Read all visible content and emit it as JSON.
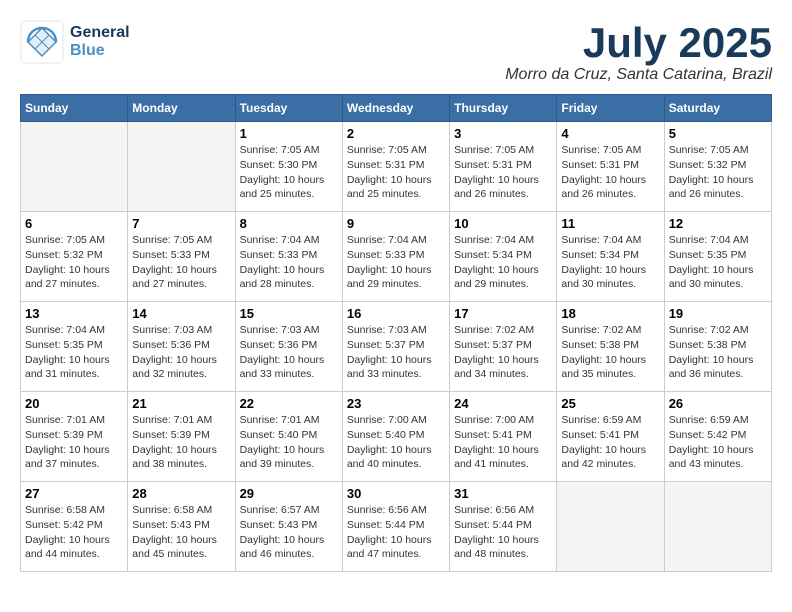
{
  "header": {
    "logo_general": "General",
    "logo_blue": "Blue",
    "month_title": "July 2025",
    "location": "Morro da Cruz, Santa Catarina, Brazil"
  },
  "weekdays": [
    "Sunday",
    "Monday",
    "Tuesday",
    "Wednesday",
    "Thursday",
    "Friday",
    "Saturday"
  ],
  "weeks": [
    [
      {
        "date": "",
        "info": ""
      },
      {
        "date": "",
        "info": ""
      },
      {
        "date": "1",
        "sunrise": "Sunrise: 7:05 AM",
        "sunset": "Sunset: 5:30 PM",
        "daylight": "Daylight: 10 hours and 25 minutes."
      },
      {
        "date": "2",
        "sunrise": "Sunrise: 7:05 AM",
        "sunset": "Sunset: 5:31 PM",
        "daylight": "Daylight: 10 hours and 25 minutes."
      },
      {
        "date": "3",
        "sunrise": "Sunrise: 7:05 AM",
        "sunset": "Sunset: 5:31 PM",
        "daylight": "Daylight: 10 hours and 26 minutes."
      },
      {
        "date": "4",
        "sunrise": "Sunrise: 7:05 AM",
        "sunset": "Sunset: 5:31 PM",
        "daylight": "Daylight: 10 hours and 26 minutes."
      },
      {
        "date": "5",
        "sunrise": "Sunrise: 7:05 AM",
        "sunset": "Sunset: 5:32 PM",
        "daylight": "Daylight: 10 hours and 26 minutes."
      }
    ],
    [
      {
        "date": "6",
        "sunrise": "Sunrise: 7:05 AM",
        "sunset": "Sunset: 5:32 PM",
        "daylight": "Daylight: 10 hours and 27 minutes."
      },
      {
        "date": "7",
        "sunrise": "Sunrise: 7:05 AM",
        "sunset": "Sunset: 5:33 PM",
        "daylight": "Daylight: 10 hours and 27 minutes."
      },
      {
        "date": "8",
        "sunrise": "Sunrise: 7:04 AM",
        "sunset": "Sunset: 5:33 PM",
        "daylight": "Daylight: 10 hours and 28 minutes."
      },
      {
        "date": "9",
        "sunrise": "Sunrise: 7:04 AM",
        "sunset": "Sunset: 5:33 PM",
        "daylight": "Daylight: 10 hours and 29 minutes."
      },
      {
        "date": "10",
        "sunrise": "Sunrise: 7:04 AM",
        "sunset": "Sunset: 5:34 PM",
        "daylight": "Daylight: 10 hours and 29 minutes."
      },
      {
        "date": "11",
        "sunrise": "Sunrise: 7:04 AM",
        "sunset": "Sunset: 5:34 PM",
        "daylight": "Daylight: 10 hours and 30 minutes."
      },
      {
        "date": "12",
        "sunrise": "Sunrise: 7:04 AM",
        "sunset": "Sunset: 5:35 PM",
        "daylight": "Daylight: 10 hours and 30 minutes."
      }
    ],
    [
      {
        "date": "13",
        "sunrise": "Sunrise: 7:04 AM",
        "sunset": "Sunset: 5:35 PM",
        "daylight": "Daylight: 10 hours and 31 minutes."
      },
      {
        "date": "14",
        "sunrise": "Sunrise: 7:03 AM",
        "sunset": "Sunset: 5:36 PM",
        "daylight": "Daylight: 10 hours and 32 minutes."
      },
      {
        "date": "15",
        "sunrise": "Sunrise: 7:03 AM",
        "sunset": "Sunset: 5:36 PM",
        "daylight": "Daylight: 10 hours and 33 minutes."
      },
      {
        "date": "16",
        "sunrise": "Sunrise: 7:03 AM",
        "sunset": "Sunset: 5:37 PM",
        "daylight": "Daylight: 10 hours and 33 minutes."
      },
      {
        "date": "17",
        "sunrise": "Sunrise: 7:02 AM",
        "sunset": "Sunset: 5:37 PM",
        "daylight": "Daylight: 10 hours and 34 minutes."
      },
      {
        "date": "18",
        "sunrise": "Sunrise: 7:02 AM",
        "sunset": "Sunset: 5:38 PM",
        "daylight": "Daylight: 10 hours and 35 minutes."
      },
      {
        "date": "19",
        "sunrise": "Sunrise: 7:02 AM",
        "sunset": "Sunset: 5:38 PM",
        "daylight": "Daylight: 10 hours and 36 minutes."
      }
    ],
    [
      {
        "date": "20",
        "sunrise": "Sunrise: 7:01 AM",
        "sunset": "Sunset: 5:39 PM",
        "daylight": "Daylight: 10 hours and 37 minutes."
      },
      {
        "date": "21",
        "sunrise": "Sunrise: 7:01 AM",
        "sunset": "Sunset: 5:39 PM",
        "daylight": "Daylight: 10 hours and 38 minutes."
      },
      {
        "date": "22",
        "sunrise": "Sunrise: 7:01 AM",
        "sunset": "Sunset: 5:40 PM",
        "daylight": "Daylight: 10 hours and 39 minutes."
      },
      {
        "date": "23",
        "sunrise": "Sunrise: 7:00 AM",
        "sunset": "Sunset: 5:40 PM",
        "daylight": "Daylight: 10 hours and 40 minutes."
      },
      {
        "date": "24",
        "sunrise": "Sunrise: 7:00 AM",
        "sunset": "Sunset: 5:41 PM",
        "daylight": "Daylight: 10 hours and 41 minutes."
      },
      {
        "date": "25",
        "sunrise": "Sunrise: 6:59 AM",
        "sunset": "Sunset: 5:41 PM",
        "daylight": "Daylight: 10 hours and 42 minutes."
      },
      {
        "date": "26",
        "sunrise": "Sunrise: 6:59 AM",
        "sunset": "Sunset: 5:42 PM",
        "daylight": "Daylight: 10 hours and 43 minutes."
      }
    ],
    [
      {
        "date": "27",
        "sunrise": "Sunrise: 6:58 AM",
        "sunset": "Sunset: 5:42 PM",
        "daylight": "Daylight: 10 hours and 44 minutes."
      },
      {
        "date": "28",
        "sunrise": "Sunrise: 6:58 AM",
        "sunset": "Sunset: 5:43 PM",
        "daylight": "Daylight: 10 hours and 45 minutes."
      },
      {
        "date": "29",
        "sunrise": "Sunrise: 6:57 AM",
        "sunset": "Sunset: 5:43 PM",
        "daylight": "Daylight: 10 hours and 46 minutes."
      },
      {
        "date": "30",
        "sunrise": "Sunrise: 6:56 AM",
        "sunset": "Sunset: 5:44 PM",
        "daylight": "Daylight: 10 hours and 47 minutes."
      },
      {
        "date": "31",
        "sunrise": "Sunrise: 6:56 AM",
        "sunset": "Sunset: 5:44 PM",
        "daylight": "Daylight: 10 hours and 48 minutes."
      },
      {
        "date": "",
        "info": ""
      },
      {
        "date": "",
        "info": ""
      }
    ]
  ]
}
